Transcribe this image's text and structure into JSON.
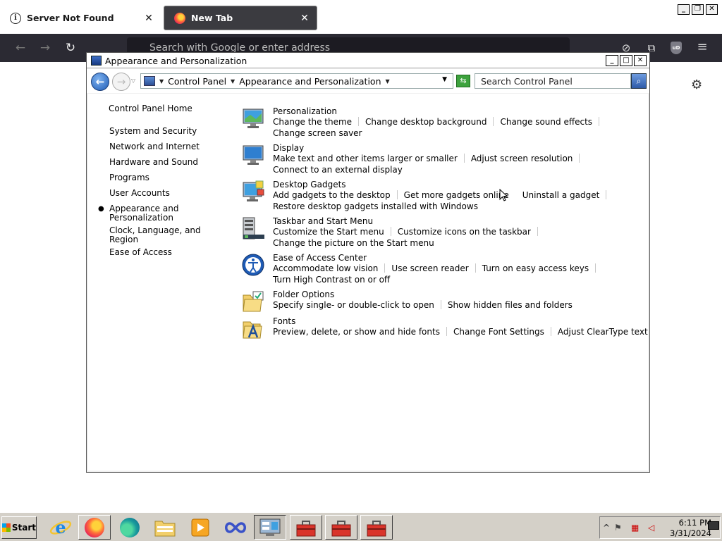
{
  "browser": {
    "tabs": [
      {
        "label": "Server Not Found",
        "close": "✕",
        "icon": "info-icon"
      },
      {
        "label": "New Tab",
        "close": "✕",
        "icon": "firefox-icon"
      }
    ],
    "url_placeholder": "Search with Google or enter address",
    "nav": {
      "back": "←",
      "forward": "→",
      "reload": "↻"
    },
    "right_icons": {
      "pocket": "⊘",
      "extensions": "⧉",
      "menu": "≡",
      "ublock": "uD"
    },
    "window_buttons": {
      "minimize": "_",
      "restore": "❐",
      "close": "✕"
    },
    "settings_icon": "⚙"
  },
  "control_panel": {
    "title": "Appearance and Personalization",
    "window_buttons": {
      "minimize": "_",
      "maximize": "□",
      "close": "✕"
    },
    "breadcrumb": [
      "Control Panel",
      "Appearance and Personalization"
    ],
    "search_placeholder": "Search Control Panel",
    "sidebar": {
      "home": "Control Panel Home",
      "items": [
        {
          "label": "System and Security",
          "current": false
        },
        {
          "label": "Network and Internet",
          "current": false
        },
        {
          "label": "Hardware and Sound",
          "current": false
        },
        {
          "label": "Programs",
          "current": false
        },
        {
          "label": "User Accounts",
          "current": false
        },
        {
          "label": "Appearance and Personalization",
          "current": true
        },
        {
          "label": "Clock, Language, and Region",
          "current": false
        },
        {
          "label": "Ease of Access",
          "current": false
        }
      ]
    },
    "categories": [
      {
        "title": "Personalization",
        "icon": "personalization-icon",
        "links": [
          "Change the theme",
          "Change desktop background",
          "Change sound effects",
          "Change screen saver"
        ]
      },
      {
        "title": "Display",
        "icon": "display-icon",
        "links": [
          "Make text and other items larger or smaller",
          "Adjust screen resolution",
          "Connect to an external display"
        ]
      },
      {
        "title": "Desktop Gadgets",
        "icon": "gadgets-icon",
        "links": [
          "Add gadgets to the desktop",
          "Get more gadgets online",
          "Uninstall a gadget",
          "Restore desktop gadgets installed with Windows"
        ]
      },
      {
        "title": "Taskbar and Start Menu",
        "icon": "taskbar-icon",
        "links": [
          "Customize the Start menu",
          "Customize icons on the taskbar",
          "Change the picture on the Start menu"
        ]
      },
      {
        "title": "Ease of Access Center",
        "icon": "ease-of-access-icon",
        "links": [
          "Accommodate low vision",
          "Use screen reader",
          "Turn on easy access keys",
          "Turn High Contrast on or off"
        ]
      },
      {
        "title": "Folder Options",
        "icon": "folder-options-icon",
        "links": [
          "Specify single- or double-click to open",
          "Show hidden files and folders"
        ]
      },
      {
        "title": "Fonts",
        "icon": "fonts-icon",
        "links": [
          "Preview, delete, or show and hide fonts",
          "Change Font Settings",
          "Adjust ClearType text"
        ]
      }
    ]
  },
  "taskbar": {
    "start_label": "Start",
    "pinned": [
      "internet-explorer-icon",
      "firefox-icon",
      "edge-icon",
      "file-explorer-icon",
      "media-player-icon",
      "infinity-app-icon",
      "control-panel-icon",
      "toolbox-icon",
      "toolbox-icon",
      "toolbox-icon"
    ],
    "tray": {
      "expand": "^",
      "time": "6:11 PM",
      "date": "3/31/2024"
    }
  }
}
